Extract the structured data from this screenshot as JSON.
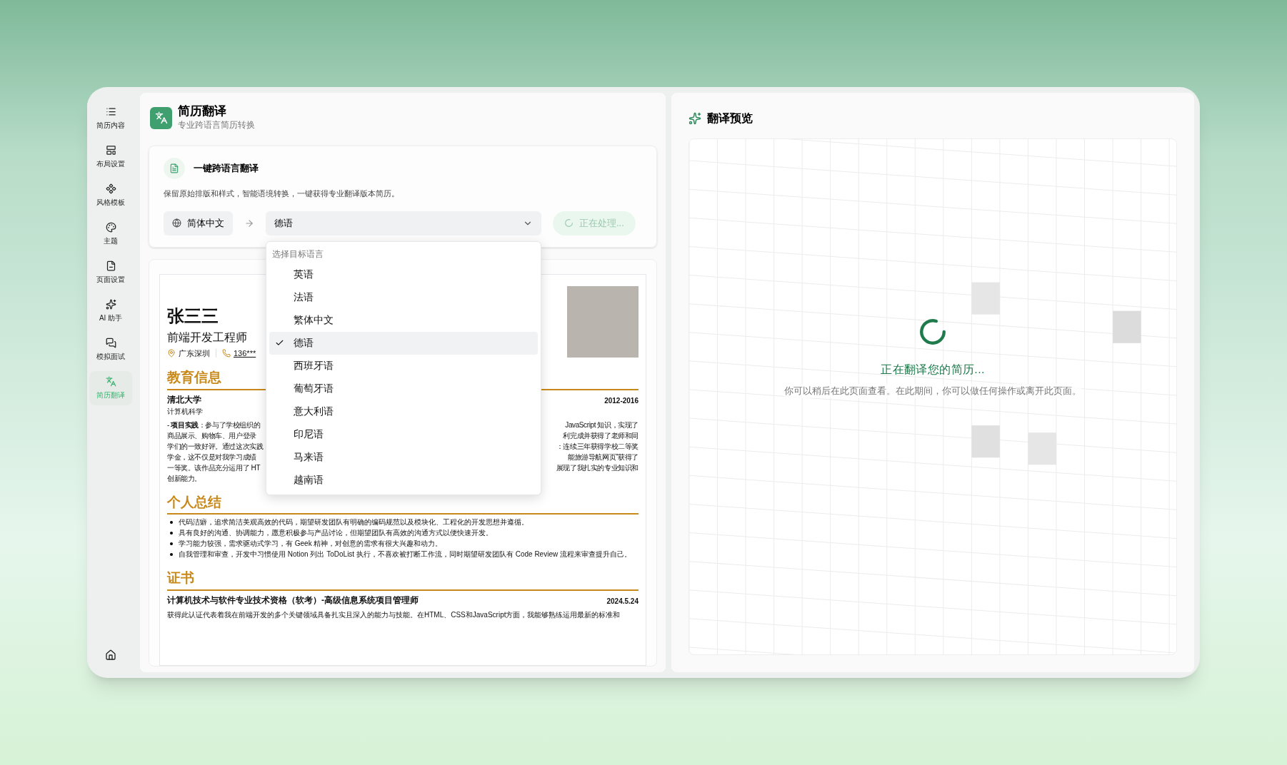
{
  "sidebar": {
    "items": [
      {
        "label": "简历内容",
        "selected": false
      },
      {
        "label": "布局设置",
        "selected": false
      },
      {
        "label": "风格模板",
        "selected": false
      },
      {
        "label": "主题",
        "selected": false
      },
      {
        "label": "页面设置",
        "selected": false
      },
      {
        "label": "AI 助手",
        "selected": false
      },
      {
        "label": "模拟面试",
        "selected": false
      },
      {
        "label": "简历翻译",
        "selected": true
      }
    ]
  },
  "header": {
    "title": "简历翻译",
    "subtitle": "专业跨语言简历转换"
  },
  "translate_card": {
    "title": "一键跨语言翻译",
    "description": "保留原始排版和样式，智能语境转换，一键获得专业翻译版本简历。",
    "source_language": "简体中文",
    "target_language": "德语",
    "button": "正在处理...",
    "processing": true
  },
  "dropdown": {
    "heading": "选择目标语言",
    "options": [
      {
        "label": "英语",
        "selected": false
      },
      {
        "label": "法语",
        "selected": false
      },
      {
        "label": "繁体中文",
        "selected": false
      },
      {
        "label": "德语",
        "selected": true
      },
      {
        "label": "西班牙语",
        "selected": false
      },
      {
        "label": "葡萄牙语",
        "selected": false
      },
      {
        "label": "意大利语",
        "selected": false
      },
      {
        "label": "印尼语",
        "selected": false
      },
      {
        "label": "马来语",
        "selected": false
      },
      {
        "label": "越南语",
        "selected": false
      }
    ]
  },
  "resume": {
    "name": "张三三",
    "role": "前端开发工程师",
    "location": "广东深圳",
    "phone": "136***",
    "education": {
      "heading": "教育信息",
      "school": "清北大学",
      "major": "计算机科学",
      "period": "2012-2016",
      "lines": [
        {
          "left": "- **项目实践**：参与了学校组织的",
          "right": "JavaScript 知识，实现了"
        },
        {
          "left": "商品展示、购物车、用户登录",
          "right": "利完成并获得了老师和同"
        },
        {
          "left": "学们的一致好评。通过这次实践",
          "right": "：连续三年获得学校二等奖"
        },
        {
          "left": "学金，这不仅是对我学习成绩",
          "right": "能旅游导航网页”获得了"
        },
        {
          "left": "一等奖。该作品充分运用了 HT",
          "right": "展现了我扎实的专业知识和"
        },
        {
          "left": "创新能力。"
        }
      ]
    },
    "summary": {
      "heading": "个人总结",
      "items": [
        "代码洁癖，追求简洁美观高效的代码，期望研发团队有明确的编码规范以及模块化、工程化的开发思想并遵循。",
        "具有良好的沟通、协调能力，愿意积极参与产品讨论，但期望团队有高效的沟通方式以便快速开发。",
        "学习能力较强，需求驱动式学习，有 Geek 精神，对创意的需求有很大兴趣和动力。",
        "自我管理和审查，开发中习惯使用 Notion 列出 ToDoList 执行，不喜欢被打断工作流，同时期望研发团队有 Code Review 流程来审查提升自己。"
      ]
    },
    "certificates": {
      "heading": "证书",
      "title": "计算机技术与软件专业技术资格（软考）-高级信息系统项目管理师",
      "date": "2024.5.24",
      "description": "获得此认证代表着我在前端开发的多个关键领域具备扎实且深入的能力与技能。在HTML、CSS和JavaScript方面，我能够熟练运用最新的标准和"
    }
  },
  "preview": {
    "title": "翻译预览",
    "status": "正在翻译您的简历...",
    "note": "你可以稍后在此页面查看。在此期间，你可以做任何操作或离开此页面。"
  }
}
